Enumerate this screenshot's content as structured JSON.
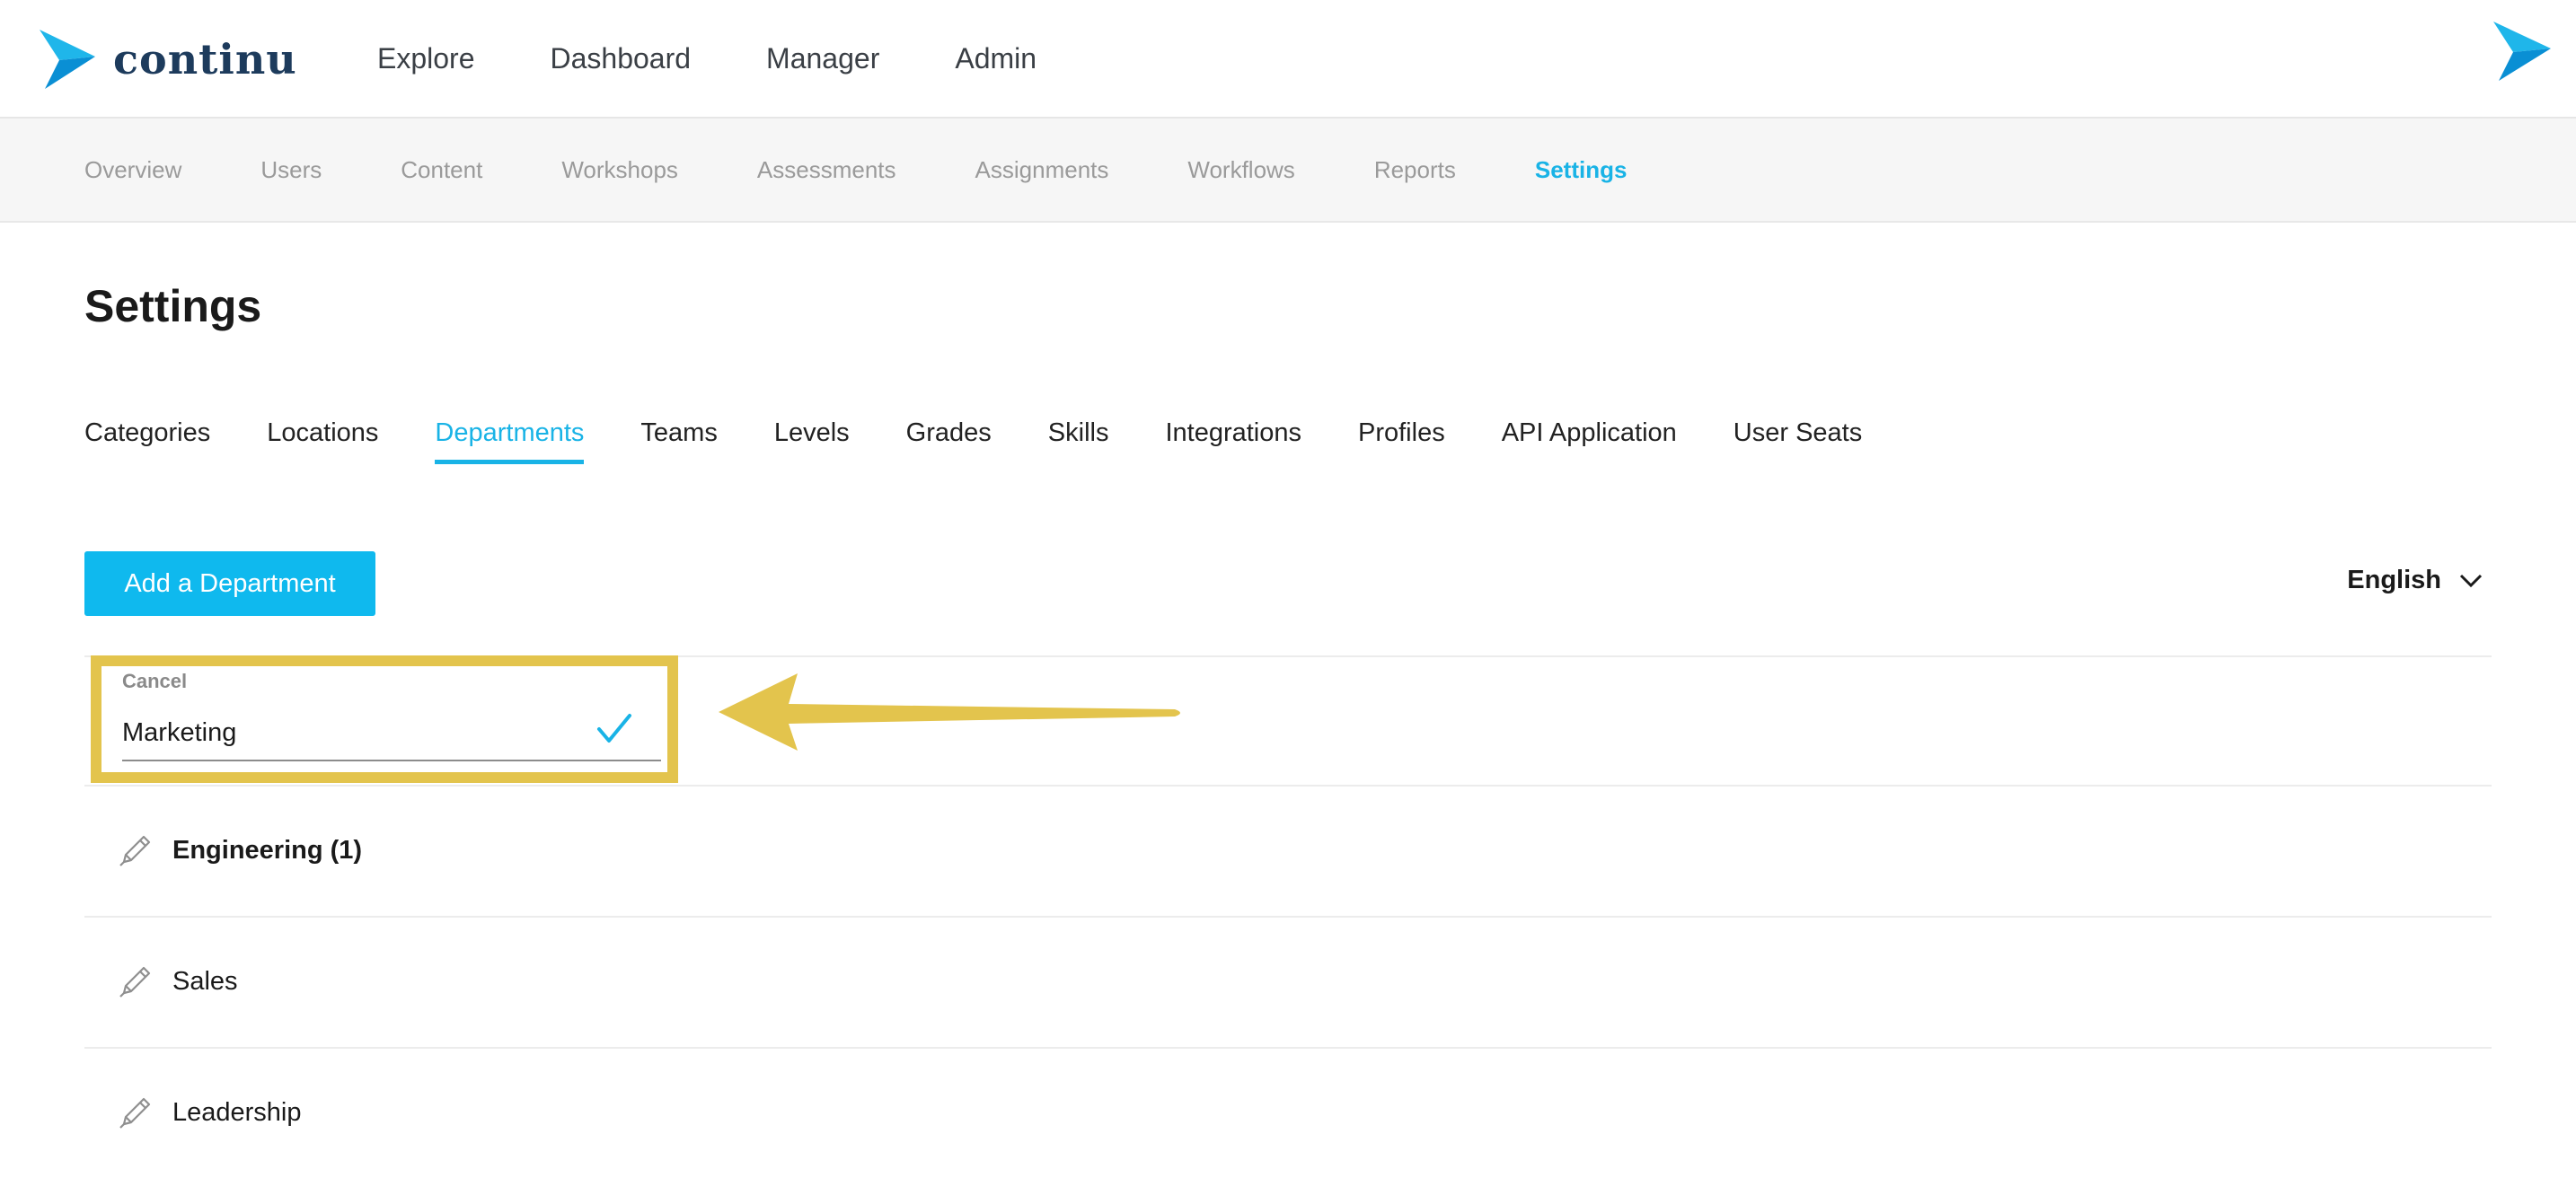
{
  "app": {
    "brand": "continu",
    "accent_color": "#19b3e6",
    "highlight_color": "#e3c44d"
  },
  "main_nav": {
    "items": [
      {
        "label": "Explore"
      },
      {
        "label": "Dashboard"
      },
      {
        "label": "Manager"
      },
      {
        "label": "Admin"
      }
    ]
  },
  "sub_nav": {
    "items": [
      {
        "label": "Overview"
      },
      {
        "label": "Users"
      },
      {
        "label": "Content"
      },
      {
        "label": "Workshops"
      },
      {
        "label": "Assessments"
      },
      {
        "label": "Assignments"
      },
      {
        "label": "Workflows"
      },
      {
        "label": "Reports"
      },
      {
        "label": "Settings",
        "active": true
      }
    ]
  },
  "page": {
    "title": "Settings"
  },
  "settings_tabs": {
    "items": [
      {
        "label": "Categories"
      },
      {
        "label": "Locations"
      },
      {
        "label": "Departments",
        "active": true
      },
      {
        "label": "Teams"
      },
      {
        "label": "Levels"
      },
      {
        "label": "Grades"
      },
      {
        "label": "Skills"
      },
      {
        "label": "Integrations"
      },
      {
        "label": "Profiles"
      },
      {
        "label": "API Application"
      },
      {
        "label": "User Seats"
      }
    ]
  },
  "actions": {
    "add_button_label": "Add a Department",
    "language": "English"
  },
  "editing": {
    "cancel_label": "Cancel",
    "value": "Marketing"
  },
  "departments": [
    {
      "name": "Engineering (1)",
      "bold": true
    },
    {
      "name": "Sales",
      "bold": false
    },
    {
      "name": "Leadership",
      "bold": false
    }
  ],
  "icons": {
    "logo": "continu-arrow-logo",
    "check": "check-icon",
    "edit": "pencil-icon",
    "dropdown": "chevron-down-icon",
    "annotation": "arrow-annotation"
  }
}
